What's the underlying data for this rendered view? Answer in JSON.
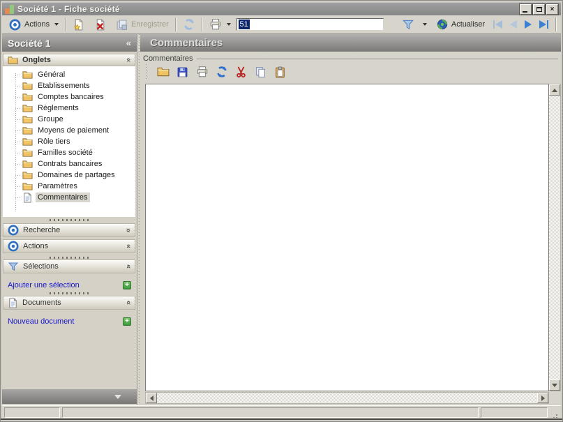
{
  "window": {
    "title": "Société 1 -  Fiche société"
  },
  "toolbar": {
    "actions_label": "Actions",
    "save_label": "Enregistrer",
    "record_field": {
      "value": "51"
    },
    "actualiser_label": "Actualiser",
    "icons": [
      "actions-target",
      "new-record",
      "delete-record",
      "save",
      "refresh",
      "print",
      "filter",
      "actualiser",
      "nav-first",
      "nav-previous",
      "nav-next",
      "nav-last"
    ]
  },
  "sidebar": {
    "title": "Société 1",
    "collapse_glyph": "«",
    "chevron_glyph": "«",
    "onglets": {
      "label": "Onglets",
      "items": [
        {
          "label": "Général"
        },
        {
          "label": "Etablissements"
        },
        {
          "label": "Comptes bancaires"
        },
        {
          "label": "Règlements"
        },
        {
          "label": "Groupe"
        },
        {
          "label": "Moyens de paiement"
        },
        {
          "label": "Rôle tiers"
        },
        {
          "label": "Familles société"
        },
        {
          "label": "Contrats bancaires"
        },
        {
          "label": "Domaines de partages"
        },
        {
          "label": "Paramètres"
        },
        {
          "label": "Commentaires",
          "selected": true
        }
      ]
    },
    "recherche_label": "Recherche",
    "actions_label": "Actions",
    "selections_label": "Sélections",
    "selections_link": "Ajouter une sélection",
    "documents_label": "Documents",
    "documents_link": "Nouveau document",
    "add_button_glyph": "+"
  },
  "main": {
    "header": "Commentaires",
    "groupbox_label": "Commentaires",
    "mini_toolbar_icons": [
      "open",
      "save",
      "print",
      "refresh",
      "cut",
      "copy",
      "paste"
    ],
    "editor_content": ""
  },
  "statusbar": {
    "panel1": "",
    "panel2": "",
    "panel3": ""
  },
  "colors": {
    "accent_blue": "#2f6fc1",
    "nav_enabled_blue": "#3c80d4",
    "nav_disabled_blue": "#a5bdd8",
    "link_blue": "#1717cf",
    "folder_tan": "#efc366",
    "selection_navy": "#0a246a",
    "plus_green": "#3c9a3c",
    "header_gray": "#8b8a88"
  }
}
